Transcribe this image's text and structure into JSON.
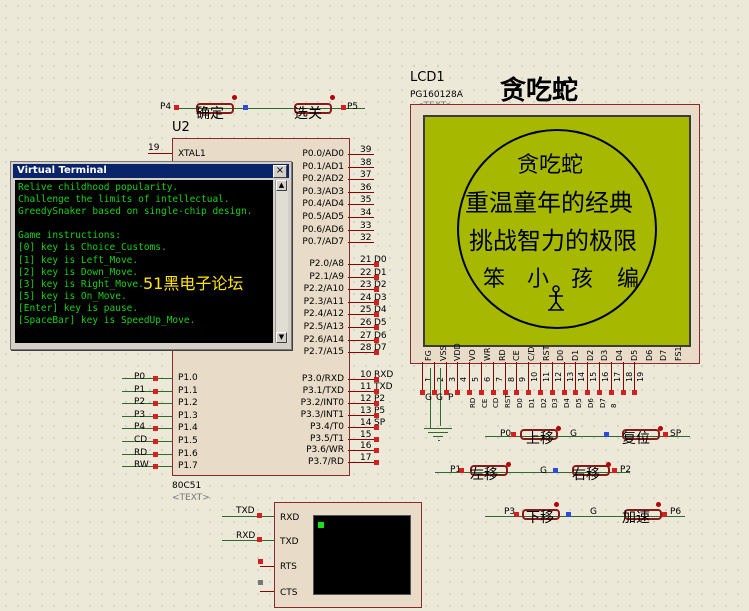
{
  "lcd": {
    "designator": "LCD1",
    "part": "PG160128A",
    "text_tag": "<TEXT>",
    "big_title": "贪吃蛇",
    "screen_title": "贪吃蛇",
    "line1": "重温童年的经典",
    "line2": "挑战智力的极限",
    "author": [
      "笨",
      "小",
      "孩",
      "编"
    ],
    "pins": [
      "FG",
      "VSS",
      "VDD",
      "VO",
      "WR",
      "RD",
      "CE",
      "C/D",
      "RST",
      "D0",
      "D1",
      "D2",
      "D3",
      "D4",
      "D5",
      "D6",
      "D7",
      "FS1"
    ],
    "pin_numbers": [
      "1",
      "2",
      "3",
      "4",
      "5",
      "6",
      "7",
      "8",
      "9",
      "10",
      "11",
      "12",
      "13",
      "14",
      "15",
      "16",
      "17",
      "18",
      "19"
    ],
    "nets": [
      "G",
      "P",
      "RW",
      "RD",
      "CE",
      "CD",
      "RST",
      "D0",
      "D1",
      "D2",
      "D3",
      "D4",
      "D5",
      "D6",
      "D7",
      "8"
    ],
    "screen_color": "#a7b800"
  },
  "mcu": {
    "designator": "U2",
    "part": "80C51",
    "text_tag": "<TEXT>",
    "xtal": {
      "num": "19",
      "label": "XTAL1"
    },
    "p0": [
      {
        "label": "P0.0/AD0",
        "num": "39"
      },
      {
        "label": "P0.1/AD1",
        "num": "38"
      },
      {
        "label": "P0.2/AD2",
        "num": "37"
      },
      {
        "label": "P0.3/AD3",
        "num": "36"
      },
      {
        "label": "P0.4/AD4",
        "num": "35"
      },
      {
        "label": "P0.5/AD5",
        "num": "34"
      },
      {
        "label": "P0.6/AD6",
        "num": "33"
      },
      {
        "label": "P0.7/AD7",
        "num": "32"
      }
    ],
    "p2": [
      {
        "label": "P2.0/A8",
        "num": "21",
        "net": "D0"
      },
      {
        "label": "P2.1/A9",
        "num": "22",
        "net": "D1"
      },
      {
        "label": "P2.2/A10",
        "num": "23",
        "net": "D2"
      },
      {
        "label": "P2.3/A11",
        "num": "24",
        "net": "D3"
      },
      {
        "label": "P2.4/A12",
        "num": "25",
        "net": "D4"
      },
      {
        "label": "P2.5/A13",
        "num": "26",
        "net": "D5"
      },
      {
        "label": "P2.6/A14",
        "num": "27",
        "net": "D6"
      },
      {
        "label": "P2.7/A15",
        "num": "28",
        "net": "D7"
      }
    ],
    "p3": [
      {
        "label": "P3.0/RXD",
        "num": "10",
        "net": "RXD"
      },
      {
        "label": "P3.1/TXD",
        "num": "11",
        "net": "TXD"
      },
      {
        "label": "P3.2/INT0",
        "num": "12",
        "net": "P2"
      },
      {
        "label": "P3.3/INT1",
        "num": "13",
        "net": "P5"
      },
      {
        "label": "P3.4/T0",
        "num": "14",
        "net": "SP"
      },
      {
        "label": "P3.5/T1",
        "num": "15",
        "net": ""
      },
      {
        "label": "P3.6/WR",
        "num": "16",
        "net": ""
      },
      {
        "label": "P3.7/RD",
        "num": "17",
        "net": ""
      }
    ],
    "p1": [
      {
        "label": "P1.0",
        "net": "P0"
      },
      {
        "label": "P1.1",
        "net": "P1"
      },
      {
        "label": "P1.2",
        "net": "P2"
      },
      {
        "label": "P1.3",
        "net": "P3"
      },
      {
        "label": "P1.4",
        "net": "P4"
      },
      {
        "label": "P1.5",
        "net": "CD"
      },
      {
        "label": "P1.6",
        "net": "RD"
      },
      {
        "label": "P1.7",
        "net": "RW"
      }
    ]
  },
  "terminal": {
    "title": "Virtual Terminal",
    "close_glyph": "×",
    "lines": [
      "Relive childhood popularity.",
      "Challenge the limits of intellectual.",
      "GreedySnaker based on single-chip design.",
      "",
      "Game instructions:",
      "[0] key is Choice_Customs.",
      "[1] key is Left_Move.",
      "[2] key is Down_Move.",
      "[3] key is Right_Move.",
      "[5] key is On_Move.",
      "[Enter] key is pause.",
      "[SpaceBar] key is SpeedUp_Move."
    ],
    "text_color": "#18d018",
    "watermark": "51黑电子论坛"
  },
  "vterm_device": {
    "pins": [
      "RXD",
      "TXD",
      "RTS",
      "CTS"
    ],
    "nets": [
      "TXD",
      "RXD"
    ]
  },
  "buttons_top": {
    "left_net": "P4",
    "right_net": "P5",
    "confirm": "确定",
    "select": "选关"
  },
  "buttons_right": {
    "up": "上移",
    "reset": "复位",
    "left": "左移",
    "right": "右移",
    "down": "下移",
    "accel": "加速",
    "nets": {
      "up": "P0",
      "reset": "SP",
      "left": "P1",
      "right": "P2",
      "down": "P3",
      "accel": "P6"
    },
    "ground": "G"
  },
  "gnd_nets": [
    "G",
    "G",
    "P"
  ]
}
